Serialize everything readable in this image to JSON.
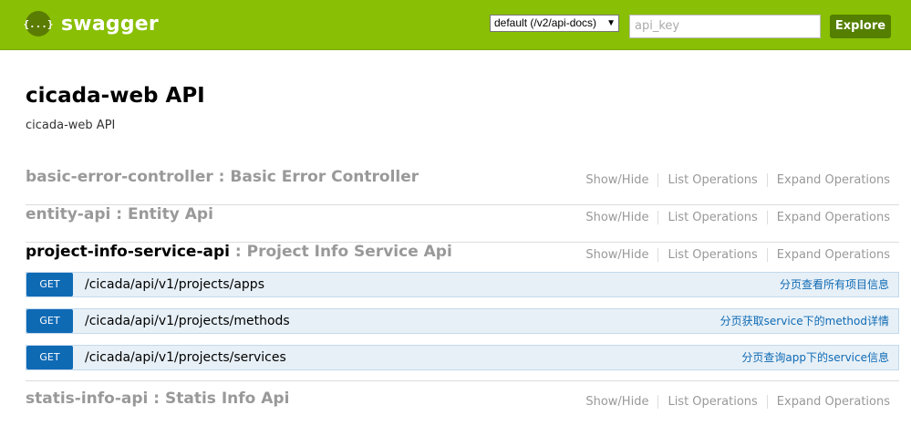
{
  "header": {
    "logo_glyph": "{...}",
    "logo_text": "swagger",
    "api_select": "default (/v2/api-docs)",
    "api_key_placeholder": "api_key",
    "explore_label": "Explore",
    "bg_color": "#89bf04"
  },
  "info": {
    "title": "cicada-web API",
    "description": "cicada-web API"
  },
  "resource_links": {
    "show_hide": "Show/Hide",
    "list_ops": "List Operations",
    "expand_ops": "Expand Operations"
  },
  "resources": [
    {
      "name": "basic-error-controller",
      "sep": " : ",
      "desc": "Basic Error Controller"
    },
    {
      "name": "entity-api",
      "sep": " : ",
      "desc": "Entity Api"
    },
    {
      "name": "project-info-service-api",
      "sep": " : ",
      "desc": "Project Info Service Api"
    },
    {
      "name": "statis-info-api",
      "sep": " : ",
      "desc": "Statis Info Api"
    }
  ],
  "operations": [
    {
      "method": "GET",
      "path": "/cicada/api/v1/projects/apps",
      "summary": "分页查看所有项目信息"
    },
    {
      "method": "GET",
      "path": "/cicada/api/v1/projects/methods",
      "summary": "分页获取service下的method详情"
    },
    {
      "method": "GET",
      "path": "/cicada/api/v1/projects/services",
      "summary": "分页查询app下的service信息"
    }
  ]
}
